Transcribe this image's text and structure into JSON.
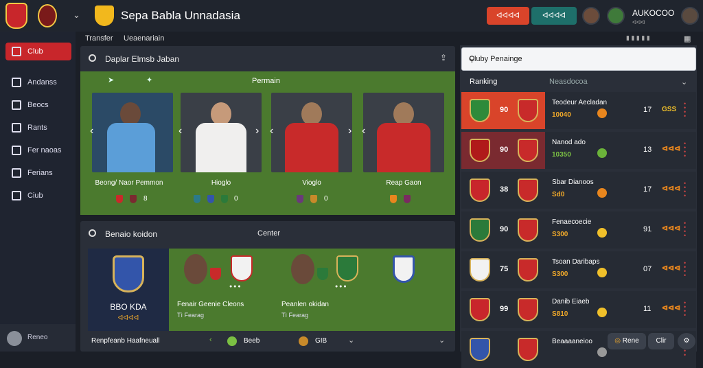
{
  "app": {
    "title": "Sepa Babla Unnadasia"
  },
  "header": {
    "btn_red": "ᐊᐊᐊᐊ",
    "btn_teal": "ᐊᐊᐊᐊ",
    "user_name": "AUKOCOO",
    "user_sub": "ᐊᐊᐊ"
  },
  "tabs": [
    "Transfer",
    "Ueaenariain"
  ],
  "sidebar": {
    "items": [
      {
        "label": "Club",
        "active": true,
        "icon": "home-icon"
      },
      {
        "label": "Andanss",
        "icon": "house-icon"
      },
      {
        "label": "Beocs",
        "icon": "book-icon"
      },
      {
        "label": "Rants",
        "icon": "doc-icon"
      },
      {
        "label": "Fer naoas",
        "icon": "edit-icon"
      },
      {
        "label": "Ferians",
        "icon": "grid-icon"
      },
      {
        "label": "Ciub",
        "icon": "external-icon"
      }
    ],
    "bottom": "Reneo"
  },
  "players_panel": {
    "search_placeholder": "Daplar Elmsb Jaban",
    "section_label": "Permain",
    "players": [
      {
        "name": "Beong/ Naor Pemmon",
        "shirt": "#5b9ed8",
        "stat": "8"
      },
      {
        "name": "Hioglo",
        "shirt": "#f0efee",
        "stat": "0"
      },
      {
        "name": "Vioglo",
        "shirt": "#c82a2a",
        "stat": "0"
      },
      {
        "name": "Reap Gaon",
        "shirt": "#c82a2a",
        "stat": ""
      }
    ]
  },
  "bottom_panel": {
    "title": "Benaio koidon",
    "center": "Center",
    "club_name": "BBO KDA",
    "club_sub": "ᐊᐊᐊᐊ",
    "p1_name": "Fenair Geenie Cleons",
    "p1_sub": "Tì Fearag",
    "p2_name": "Peanlen okidan",
    "p2_sub": "Tì Fearag",
    "footer_label": "Renpfeanb Haafneuall",
    "footer_mid": "Beeb",
    "footer_right": "GIB"
  },
  "rankings": {
    "search_placeholder": "Cluby Penainge",
    "head_left": "Ranking",
    "head_right": "Neasdocoa",
    "rows": [
      {
        "rank": "90",
        "name": "Teodeur Aecladan",
        "score": "10040",
        "pts": "17",
        "form": "GSS",
        "coin": "#e8861e",
        "bg": "#d9442a",
        "crest": "#2e8a3a",
        "scorecolor": "#f0a92a"
      },
      {
        "rank": "90",
        "name": "Nanod ado",
        "score": "10350",
        "pts": "13",
        "form": "ᐊᐊᐊ",
        "coin": "#6bb33a",
        "bg": "#7a2a30",
        "crest": "#b01a1a",
        "scorecolor": "#7bc043"
      },
      {
        "rank": "38",
        "name": "Sbar Dianoos",
        "score": "Sd0",
        "pts": "17",
        "form": "ᐊᐊᐊ",
        "coin": "#e8861e",
        "bg": "#262b34",
        "crest": "#c8262b",
        "scorecolor": "#f0a92a"
      },
      {
        "rank": "90",
        "name": "Fenaecoecie",
        "score": "S300",
        "pts": "91",
        "form": "ᐊᐊᐊ",
        "coin": "#f0c02a",
        "bg": "#262b34",
        "crest": "#2b7a3a",
        "scorecolor": "#f0a92a"
      },
      {
        "rank": "75",
        "name": "Tsoan Daribaps",
        "score": "S300",
        "pts": "07",
        "form": "ᐊᐊᐊ",
        "coin": "#f0c02a",
        "bg": "#262b34",
        "crest": "#f2f2f2",
        "scorecolor": "#f0a92a"
      },
      {
        "rank": "99",
        "name": "Danib Eiaeb",
        "score": "S810",
        "pts": "11",
        "form": "ᐊᐊᐊ",
        "coin": "#f0c02a",
        "bg": "#262b34",
        "crest": "#c8262b",
        "scorecolor": "#f0a92a"
      },
      {
        "rank": "",
        "name": "Beaaaaneioo",
        "score": "",
        "pts": "",
        "form": "",
        "coin": "#999",
        "bg": "#262b34",
        "crest": "#3355aa",
        "scorecolor": "#f0a92a"
      }
    ],
    "footer_btn1": "Rene",
    "footer_btn2": "Clir"
  }
}
